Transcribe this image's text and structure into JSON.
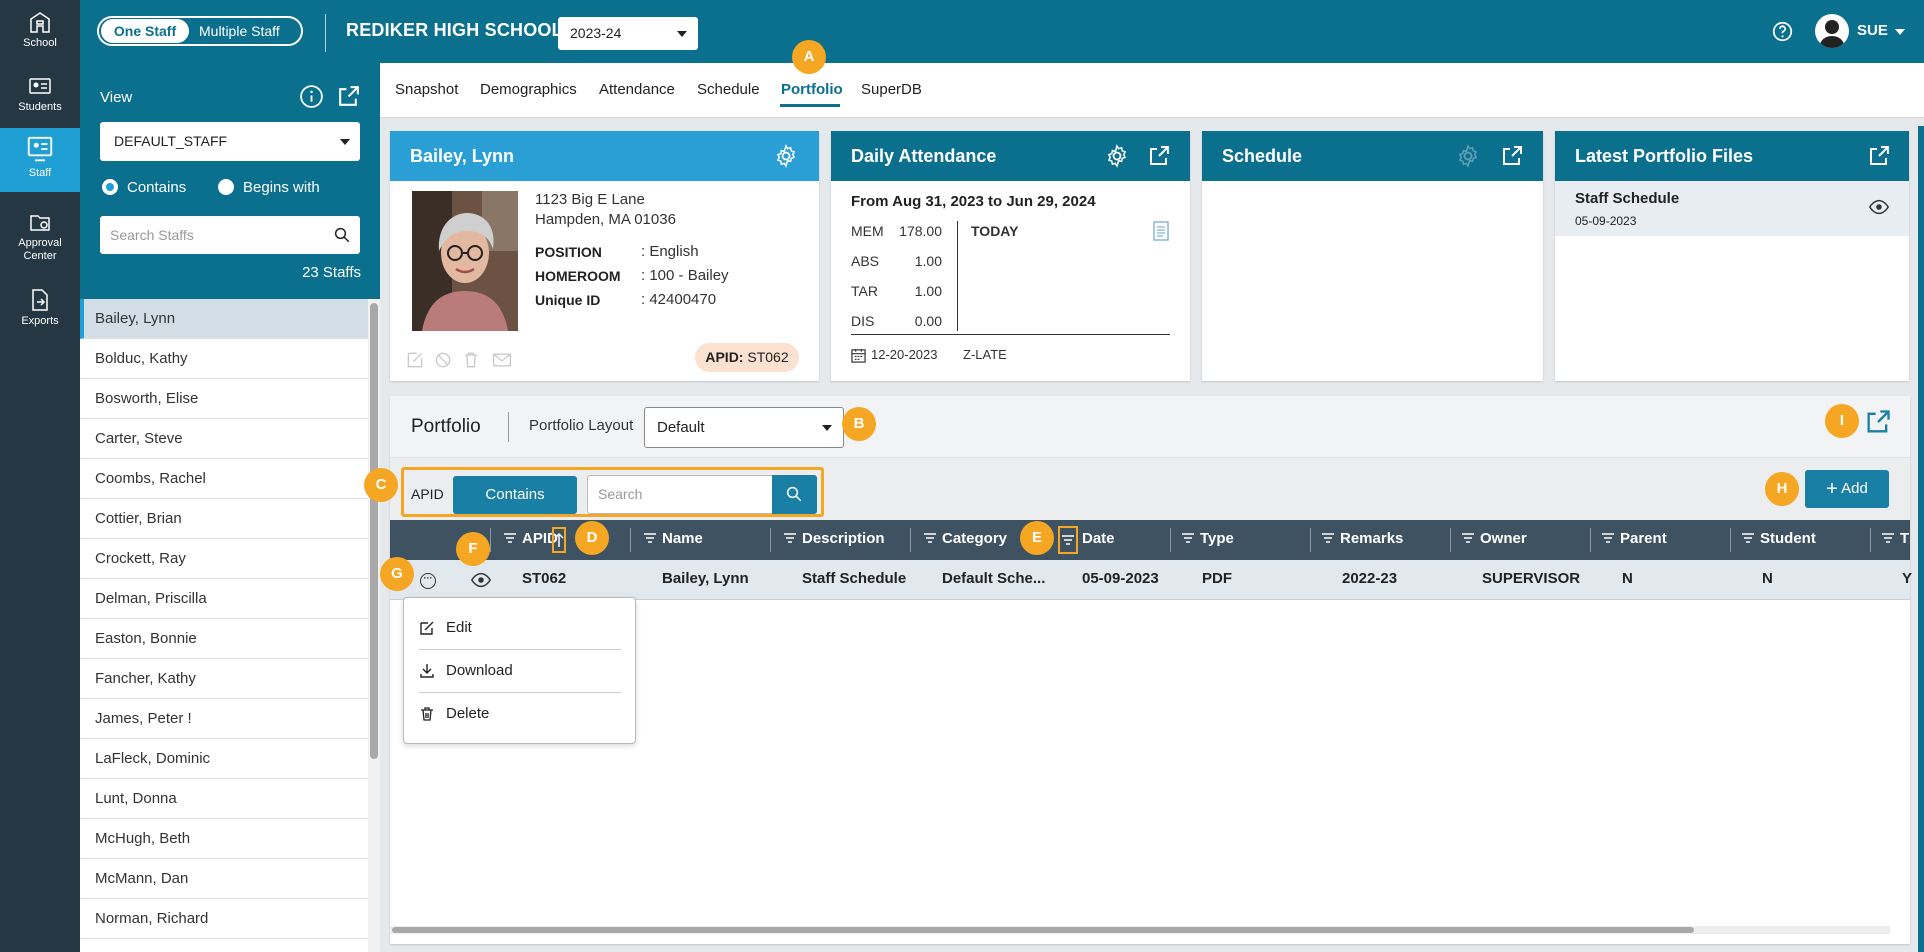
{
  "rail": {
    "items": [
      {
        "label": "School"
      },
      {
        "label": "Students"
      },
      {
        "label": "Staff"
      },
      {
        "label": "Approval Center"
      },
      {
        "label": "Exports"
      }
    ]
  },
  "header": {
    "toggle_on": "One Staff",
    "toggle_off": "Multiple Staff",
    "school_name": "REDIKER HIGH SCHOOL",
    "year": "2023-24",
    "user": "SUE"
  },
  "staff_panel": {
    "view_label": "View",
    "view_value": "DEFAULT_STAFF",
    "radio_contains": "Contains",
    "radio_begins": "Begins with",
    "search_placeholder": "Search Staffs",
    "count": "23 Staffs"
  },
  "staff_list": [
    "Bailey, Lynn",
    "Bolduc, Kathy",
    "Bosworth, Elise",
    "Carter, Steve",
    "Coombs, Rachel",
    "Cottier, Brian",
    "Crockett, Ray",
    "Delman, Priscilla",
    "Easton, Bonnie",
    "Fancher, Kathy",
    "James, Peter !",
    "LaFleck, Dominic",
    "Lunt, Donna",
    "McHugh, Beth",
    "McMann, Dan",
    "Norman, Richard"
  ],
  "tabs": [
    "Snapshot",
    "Demographics",
    "Attendance",
    "Schedule",
    "Portfolio",
    "SuperDB"
  ],
  "badges": {
    "a": "A",
    "b": "B",
    "c": "C",
    "d": "D",
    "e": "E",
    "f": "F",
    "g": "G",
    "h": "H",
    "i": "I"
  },
  "profile": {
    "name": "Bailey, Lynn",
    "address1": "1123 Big E Lane",
    "address2": "Hampden, MA 01036",
    "fields": [
      {
        "k": "POSITION",
        "v": ": English"
      },
      {
        "k": "HOMEROOM",
        "v": ": 100 - Bailey"
      },
      {
        "k": "Unique ID",
        "v": ": 42400470"
      }
    ],
    "apid_label": "APID:",
    "apid_value": "ST062"
  },
  "attendance": {
    "title": "Daily Attendance",
    "range": "From Aug 31, 2023 to Jun 29, 2024",
    "rows": [
      {
        "k": "MEM",
        "v": "178.00"
      },
      {
        "k": "ABS",
        "v": "1.00"
      },
      {
        "k": "TAR",
        "v": "1.00"
      },
      {
        "k": "DIS",
        "v": "0.00"
      }
    ],
    "today": "TODAY",
    "foot_date": "12-20-2023",
    "foot_code": "Z-LATE"
  },
  "schedule": {
    "title": "Schedule"
  },
  "latest": {
    "title": "Latest Portfolio Files",
    "file_name": "Staff Schedule",
    "file_date": "05-09-2023"
  },
  "portfolio": {
    "title": "Portfolio",
    "layout_label": "Portfolio Layout",
    "layout_value": "Default",
    "search_field": "APID",
    "search_mode": "Contains",
    "search_placeholder": "Search",
    "add_label": "Add",
    "columns": [
      "APID",
      "Name",
      "Description",
      "Category",
      "Date",
      "Type",
      "Remarks",
      "Owner",
      "Parent",
      "Student",
      "T"
    ],
    "row": [
      "ST062",
      "Bailey, Lynn",
      "Staff Schedule",
      "Default Sche...",
      "05-09-2023",
      "PDF",
      "2022-23",
      "SUPERVISOR",
      "N",
      "N",
      "Y"
    ],
    "menu": [
      "Edit",
      "Download",
      "Delete"
    ]
  },
  "colors": {
    "header": "#0b6f8e",
    "accent": "#1f9fd4",
    "badge": "#f5a623",
    "grid_head": "#3e5262"
  }
}
